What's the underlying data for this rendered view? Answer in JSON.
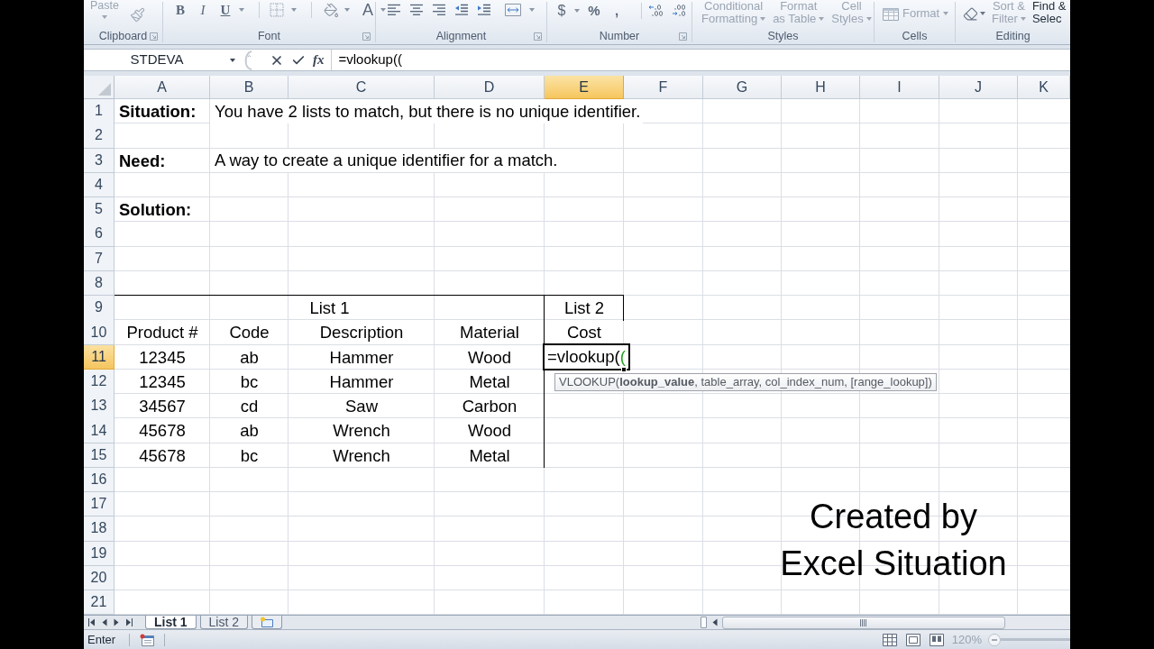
{
  "ribbon": {
    "groups": [
      {
        "label": "Clipboard",
        "buttons": [
          {
            "lines": [
              "Paste"
            ],
            "disabled": true
          }
        ]
      },
      {
        "label": "Font",
        "buttons": [
          {
            "text": "B",
            "disabled": false
          },
          {
            "text": "I",
            "disabled": false
          },
          {
            "text": "U",
            "disabled": false
          },
          {
            "text": "A",
            "disabled": false
          }
        ]
      },
      {
        "label": "Alignment"
      },
      {
        "label": "Number",
        "buttons": [
          {
            "text": "$",
            "disabled": false
          },
          {
            "text": "%",
            "disabled": false
          },
          {
            "text": ",",
            "disabled": false
          }
        ]
      },
      {
        "label": "Styles",
        "buttons": [
          {
            "lines": [
              "Conditional",
              "Formatting"
            ],
            "disabled": true
          },
          {
            "lines": [
              "Format",
              "as Table"
            ],
            "disabled": true
          },
          {
            "lines": [
              "Cell",
              "Styles"
            ],
            "disabled": true
          }
        ]
      },
      {
        "label": "Cells",
        "buttons": [
          {
            "lines": [
              "Format"
            ],
            "disabled": true
          }
        ]
      },
      {
        "label": "Editing",
        "buttons": [
          {
            "lines": [
              "Sort &",
              "Filter"
            ],
            "disabled": true
          },
          {
            "lines": [
              "Find &",
              "Selec"
            ],
            "disabled": false
          }
        ]
      }
    ]
  },
  "formula_bar": {
    "name_box": "STDEVA",
    "function_button": "fx",
    "formula": "=vlookup(("
  },
  "grid": {
    "columns": [
      {
        "label": "A",
        "selected": false
      },
      {
        "label": "B",
        "selected": false
      },
      {
        "label": "C",
        "selected": false
      },
      {
        "label": "D",
        "selected": false
      },
      {
        "label": "E",
        "selected": true
      },
      {
        "label": "F",
        "selected": false
      },
      {
        "label": "G",
        "selected": false
      },
      {
        "label": "H",
        "selected": false
      },
      {
        "label": "I",
        "selected": false
      },
      {
        "label": "J",
        "selected": false
      },
      {
        "label": "K",
        "selected": false
      }
    ],
    "rows": [
      {
        "number": "1",
        "selected": false,
        "cells": [
          {
            "kind": "heading",
            "text": "Situation:"
          },
          {
            "kind": "note",
            "text": "You have 2 lists to match, but there is no unique identifier."
          }
        ]
      },
      {
        "number": "2",
        "selected": false
      },
      {
        "number": "3",
        "selected": false,
        "cells": [
          {
            "kind": "heading",
            "text": "Need:"
          },
          {
            "kind": "note",
            "text": "A way to create a unique identifier for a match."
          }
        ]
      },
      {
        "number": "4",
        "selected": false
      },
      {
        "number": "5",
        "selected": false,
        "cells": [
          {
            "kind": "heading",
            "text": "Solution:"
          }
        ]
      },
      {
        "number": "6",
        "selected": false
      },
      {
        "number": "7",
        "selected": false
      },
      {
        "number": "8",
        "selected": false
      },
      {
        "number": "9",
        "selected": false,
        "cells": [
          {
            "kind": "merged",
            "text": "List 1",
            "border_top": true
          },
          {
            "kind": "covered"
          },
          {
            "kind": "covered"
          },
          {
            "kind": "covered"
          },
          {
            "kind": "entry",
            "text": "List 2",
            "border_top": true,
            "border_left": true,
            "border_right": true
          }
        ]
      },
      {
        "number": "10",
        "selected": false,
        "cells": [
          {
            "kind": "entry",
            "text": "Product #"
          },
          {
            "kind": "entry",
            "text": "Code"
          },
          {
            "kind": "entry",
            "text": "Description"
          },
          {
            "kind": "entry",
            "text": "Material"
          },
          {
            "kind": "entry",
            "text": "Cost",
            "border_left": true
          }
        ]
      },
      {
        "number": "11",
        "selected": true,
        "cells": [
          {
            "kind": "entry",
            "text": "12345"
          },
          {
            "kind": "entry",
            "text": "ab"
          },
          {
            "kind": "entry",
            "text": "Hammer"
          },
          {
            "kind": "entry",
            "text": "Wood"
          },
          {
            "kind": "edit",
            "parts": [
              {
                "kind": "text",
                "text": "=vlookup("
              },
              {
                "kind": "paren",
                "text": "("
              }
            ],
            "tooltip": "VLOOKUP(**lookup_value**, table_array, col_index_num, [range_lookup])"
          }
        ]
      },
      {
        "number": "12",
        "selected": false,
        "cells": [
          {
            "kind": "entry",
            "text": "12345"
          },
          {
            "kind": "entry",
            "text": "bc"
          },
          {
            "kind": "entry",
            "text": "Hammer"
          },
          {
            "kind": "entry",
            "text": "Metal"
          },
          {
            "kind": "blank",
            "border_left": true
          }
        ]
      },
      {
        "number": "13",
        "selected": false,
        "cells": [
          {
            "kind": "entry",
            "text": "34567"
          },
          {
            "kind": "entry",
            "text": "cd"
          },
          {
            "kind": "entry",
            "text": "Saw"
          },
          {
            "kind": "entry",
            "text": "Carbon"
          },
          {
            "kind": "blank",
            "border_left": true
          }
        ]
      },
      {
        "number": "14",
        "selected": false,
        "cells": [
          {
            "kind": "entry",
            "text": "45678"
          },
          {
            "kind": "entry",
            "text": "ab"
          },
          {
            "kind": "entry",
            "text": "Wrench"
          },
          {
            "kind": "entry",
            "text": "Wood"
          },
          {
            "kind": "blank",
            "border_left": true
          }
        ]
      },
      {
        "number": "15",
        "selected": false,
        "cells": [
          {
            "kind": "entry",
            "text": "45678"
          },
          {
            "kind": "entry",
            "text": "bc"
          },
          {
            "kind": "entry",
            "text": "Wrench"
          },
          {
            "kind": "entry",
            "text": "Metal"
          },
          {
            "kind": "blank",
            "border_left": true
          }
        ]
      },
      {
        "number": "16",
        "selected": false
      },
      {
        "number": "17",
        "selected": false
      },
      {
        "number": "18",
        "selected": false
      },
      {
        "number": "19",
        "selected": false
      },
      {
        "number": "20",
        "selected": false
      },
      {
        "number": "21",
        "selected": false
      }
    ]
  },
  "credit": [
    "Created by",
    "Excel Situation"
  ],
  "sheet_tabs": [
    {
      "label": "List 1",
      "selected": true
    },
    {
      "label": "List 2",
      "selected": false
    }
  ],
  "status_bar": {
    "mode": "Enter",
    "zoom": "120%"
  }
}
